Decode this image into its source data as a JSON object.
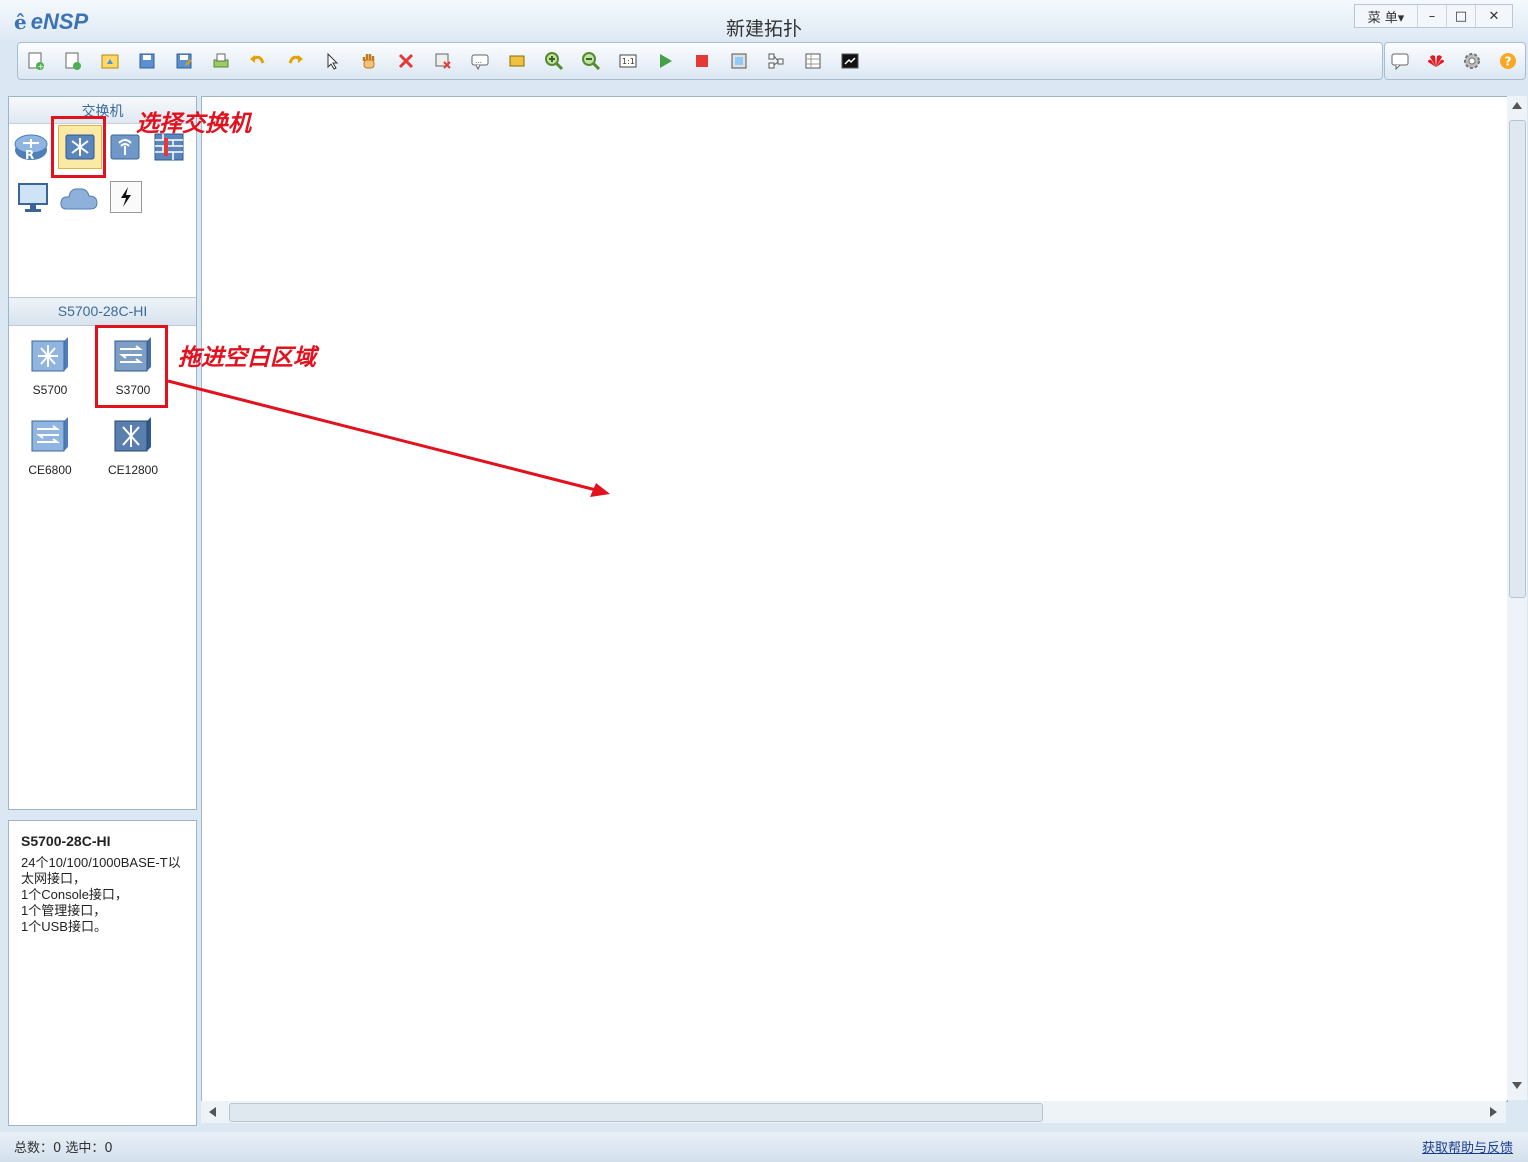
{
  "app": {
    "logo": "eNSP",
    "title": "新建拓扑"
  },
  "window_controls": {
    "menu": "菜 单▾",
    "minimize": "–",
    "maximize": "□",
    "close": "✕"
  },
  "toolbar": {
    "icons": [
      "new-topology-icon",
      "new-lab-icon",
      "open-icon",
      "save-icon",
      "save-as-icon",
      "print-icon",
      "undo-icon",
      "redo-icon",
      "select-pointer-icon",
      "pan-hand-icon",
      "delete-icon",
      "delete-link-icon",
      "text-annotation-icon",
      "rectangle-icon",
      "zoom-in-icon",
      "zoom-out-icon",
      "fit-view-icon",
      "start-device-icon",
      "stop-device-icon",
      "capture-icon",
      "topology-icon",
      "grid-icon",
      "console-icon"
    ],
    "right_icons": [
      "chat-icon",
      "huawei-logo-icon",
      "settings-icon",
      "help-icon"
    ]
  },
  "category_panel": {
    "header": "交换机",
    "categories": [
      {
        "name": "router",
        "icon": "router-icon"
      },
      {
        "name": "switch",
        "icon": "switch-icon",
        "selected": true
      },
      {
        "name": "wireless",
        "icon": "wireless-icon"
      },
      {
        "name": "firewall",
        "icon": "firewall-icon"
      },
      {
        "name": "pc",
        "icon": "pc-icon"
      },
      {
        "name": "cloud",
        "icon": "cloud-icon"
      },
      {
        "name": "link",
        "icon": "link-icon"
      }
    ]
  },
  "model_panel": {
    "header": "S5700-28C-HI",
    "devices": [
      {
        "label": "S5700"
      },
      {
        "label": "S3700"
      },
      {
        "label": "CE6800"
      },
      {
        "label": "CE12800"
      }
    ]
  },
  "description": {
    "title": "S5700-28C-HI",
    "lines": [
      "24个10/100/1000BASE-T以太网接口，",
      "1个Console接口，",
      "1个管理接口，",
      "1个USB接口。"
    ]
  },
  "annotations": {
    "select_switch": "选择交换机",
    "drag_to_blank": "拖进空白区域"
  },
  "status": {
    "total_label": "总数：0  选中：0",
    "help_link": "获取帮助与反馈"
  }
}
